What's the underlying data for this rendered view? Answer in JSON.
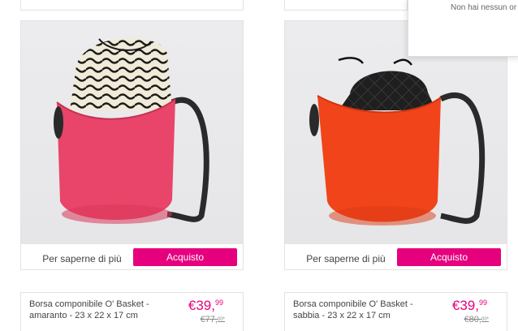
{
  "popup": {
    "message": "Non hai nessun or"
  },
  "products": [
    {
      "more_label": "Per saperne di più",
      "buy_label": "Acquisto",
      "name": "Borsa componibile O' Basket - amaranto - 23 x 22 x 17 cm",
      "price_main": "€39,",
      "price_cents": "99",
      "old_price_main": "€77,",
      "old_price_cents": "00*",
      "bag_color": "#e9446a",
      "lining": "black-and-cream wave pattern"
    },
    {
      "more_label": "Per saperne di più",
      "buy_label": "Acquisto",
      "name": "Borsa componibile O' Basket - sabbia - 23 x 22 x 17 cm",
      "price_main": "€39,",
      "price_cents": "99",
      "old_price_main": "€80,",
      "old_price_cents": "00*",
      "bag_color": "#f2441a",
      "lining": "black quilted"
    }
  ],
  "colors": {
    "accent": "#e6007e",
    "border": "#e2e2e2"
  }
}
